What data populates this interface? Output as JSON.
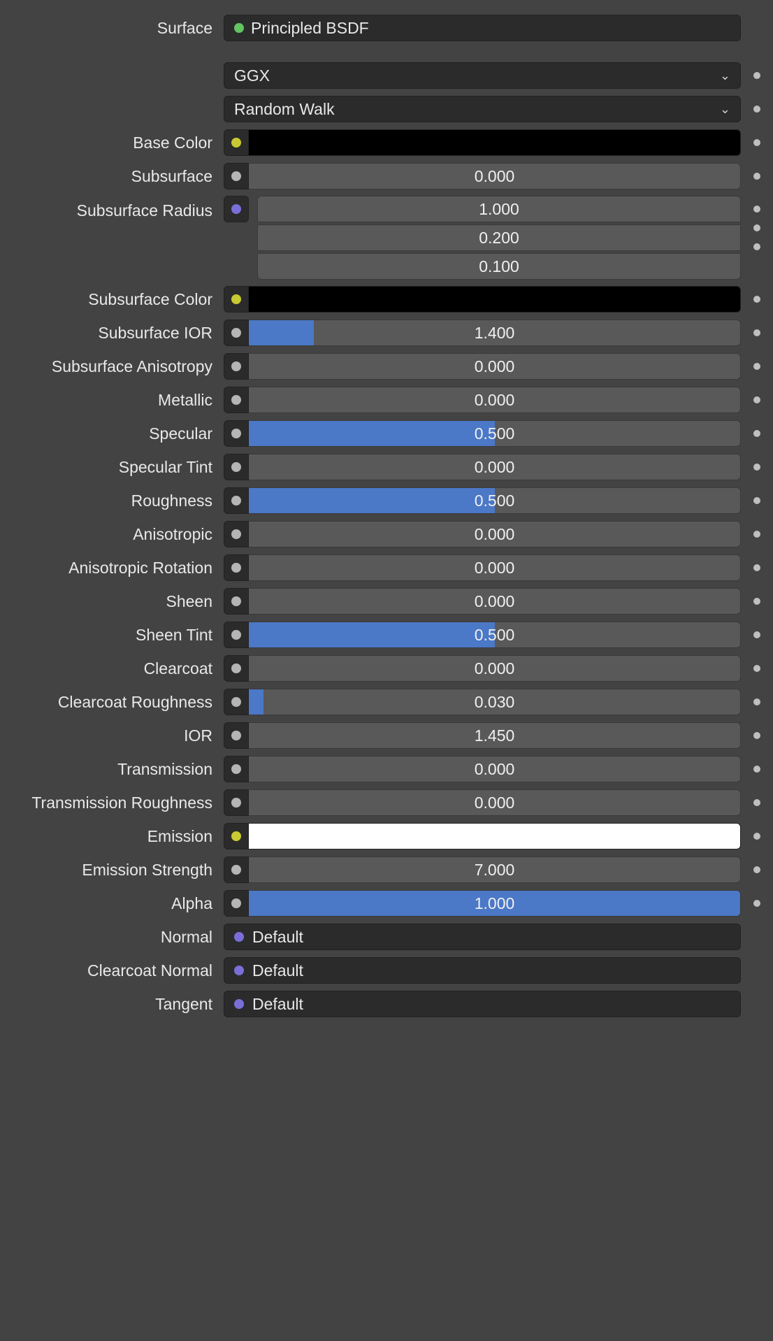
{
  "surface": {
    "label": "Surface",
    "value": "Principled BSDF"
  },
  "dropdowns": {
    "distribution": "GGX",
    "sss_method": "Random Walk"
  },
  "rows": [
    {
      "id": "base-color",
      "label": "Base Color",
      "type": "color",
      "socket": "yellow",
      "color": "#000000"
    },
    {
      "id": "subsurface",
      "label": "Subsurface",
      "type": "slider",
      "socket": "gray",
      "value": "0.000",
      "fill": 0.0
    },
    {
      "id": "subsurface-radius",
      "label": "Subsurface Radius",
      "type": "vector",
      "socket": "purple",
      "values": [
        "1.000",
        "0.200",
        "0.100"
      ]
    },
    {
      "id": "subsurface-color",
      "label": "Subsurface Color",
      "type": "color",
      "socket": "yellow",
      "color": "#000000"
    },
    {
      "id": "subsurface-ior",
      "label": "Subsurface IOR",
      "type": "slider",
      "socket": "gray",
      "value": "1.400",
      "fill": 0.133
    },
    {
      "id": "subsurface-anisotropy",
      "label": "Subsurface Anisotropy",
      "type": "slider",
      "socket": "gray",
      "value": "0.000",
      "fill": 0.0
    },
    {
      "id": "metallic",
      "label": "Metallic",
      "type": "slider",
      "socket": "gray",
      "value": "0.000",
      "fill": 0.0
    },
    {
      "id": "specular",
      "label": "Specular",
      "type": "slider",
      "socket": "gray",
      "value": "0.500",
      "fill": 0.5
    },
    {
      "id": "specular-tint",
      "label": "Specular Tint",
      "type": "slider",
      "socket": "gray",
      "value": "0.000",
      "fill": 0.0
    },
    {
      "id": "roughness",
      "label": "Roughness",
      "type": "slider",
      "socket": "gray",
      "value": "0.500",
      "fill": 0.5
    },
    {
      "id": "anisotropic",
      "label": "Anisotropic",
      "type": "slider",
      "socket": "gray",
      "value": "0.000",
      "fill": 0.0
    },
    {
      "id": "anisotropic-rotation",
      "label": "Anisotropic Rotation",
      "type": "slider",
      "socket": "gray",
      "value": "0.000",
      "fill": 0.0
    },
    {
      "id": "sheen",
      "label": "Sheen",
      "type": "slider",
      "socket": "gray",
      "value": "0.000",
      "fill": 0.0
    },
    {
      "id": "sheen-tint",
      "label": "Sheen Tint",
      "type": "slider",
      "socket": "gray",
      "value": "0.500",
      "fill": 0.5
    },
    {
      "id": "clearcoat",
      "label": "Clearcoat",
      "type": "slider",
      "socket": "gray",
      "value": "0.000",
      "fill": 0.0
    },
    {
      "id": "clearcoat-roughness",
      "label": "Clearcoat Roughness",
      "type": "slider",
      "socket": "gray",
      "value": "0.030",
      "fill": 0.03
    },
    {
      "id": "ior",
      "label": "IOR",
      "type": "slider",
      "socket": "gray",
      "value": "1.450",
      "fill": 0.0
    },
    {
      "id": "transmission",
      "label": "Transmission",
      "type": "slider",
      "socket": "gray",
      "value": "0.000",
      "fill": 0.0
    },
    {
      "id": "transmission-roughness",
      "label": "Transmission Roughness",
      "type": "slider",
      "socket": "gray",
      "value": "0.000",
      "fill": 0.0
    },
    {
      "id": "emission",
      "label": "Emission",
      "type": "color",
      "socket": "yellow",
      "color": "#ffffff"
    },
    {
      "id": "emission-strength",
      "label": "Emission Strength",
      "type": "slider",
      "socket": "gray",
      "value": "7.000",
      "fill": 0.0
    },
    {
      "id": "alpha",
      "label": "Alpha",
      "type": "slider",
      "socket": "gray",
      "value": "1.000",
      "fill": 1.0
    },
    {
      "id": "normal",
      "label": "Normal",
      "type": "link",
      "socket": "purple",
      "text": "Default"
    },
    {
      "id": "clearcoat-normal",
      "label": "Clearcoat Normal",
      "type": "link",
      "socket": "purple",
      "text": "Default"
    },
    {
      "id": "tangent",
      "label": "Tangent",
      "type": "link",
      "socket": "purple",
      "text": "Default"
    }
  ],
  "accent": "#4b78c7"
}
